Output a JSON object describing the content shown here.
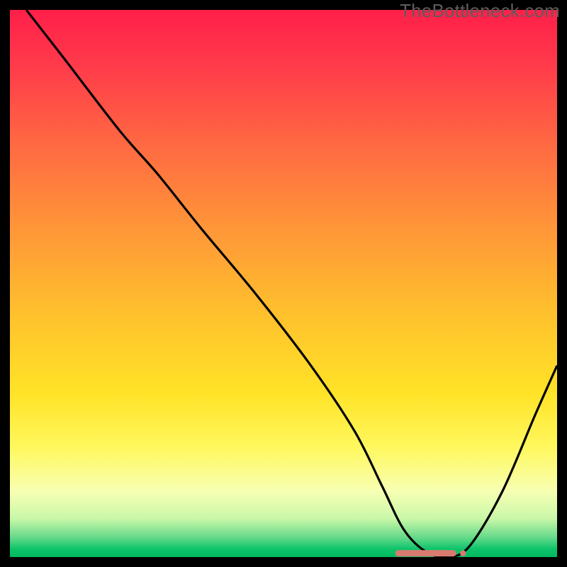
{
  "watermark": "TheBottleneck.com",
  "chart_data": {
    "type": "line",
    "title": "",
    "xlabel": "",
    "ylabel": "",
    "xlim": [
      0,
      100
    ],
    "ylim": [
      0,
      100
    ],
    "series": [
      {
        "name": "bottleneck-curve",
        "x": [
          3.0,
          10,
          20,
          27,
          35,
          45,
          55,
          63,
          68,
          72,
          76,
          80,
          84,
          90,
          96,
          100
        ],
        "values": [
          100,
          91,
          78,
          70,
          60,
          48,
          35,
          23,
          13,
          5,
          1,
          0,
          2,
          12,
          26,
          35
        ]
      }
    ],
    "marker": {
      "name": "optimal-range",
      "x_start": 71,
      "x_end": 81,
      "y": 0.7,
      "color": "#d87a6f"
    },
    "gradient_stops": [
      {
        "offset": 0.0,
        "color": "#ff1f4a"
      },
      {
        "offset": 0.1,
        "color": "#ff3a4a"
      },
      {
        "offset": 0.25,
        "color": "#ff6a42"
      },
      {
        "offset": 0.4,
        "color": "#ff9638"
      },
      {
        "offset": 0.55,
        "color": "#ffbf2d"
      },
      {
        "offset": 0.7,
        "color": "#ffe327"
      },
      {
        "offset": 0.8,
        "color": "#fff85e"
      },
      {
        "offset": 0.88,
        "color": "#f7ffb3"
      },
      {
        "offset": 0.93,
        "color": "#c9f7a8"
      },
      {
        "offset": 0.965,
        "color": "#62d989"
      },
      {
        "offset": 0.985,
        "color": "#0ec46a"
      },
      {
        "offset": 1.0,
        "color": "#00b85f"
      }
    ],
    "frame": {
      "stroke": "#000000",
      "stroke_width": 14
    }
  }
}
